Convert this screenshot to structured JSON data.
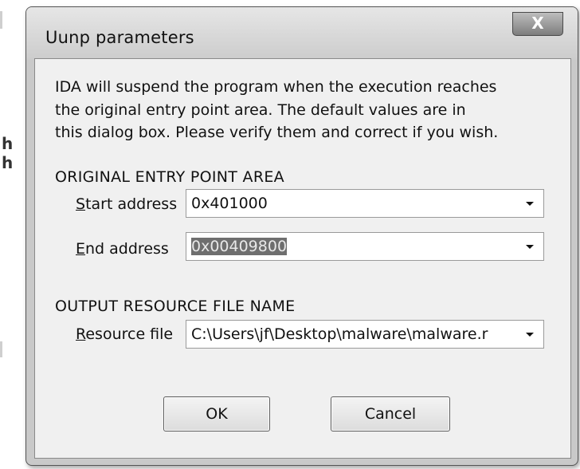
{
  "background": {
    "fragments": [
      "h",
      "h"
    ]
  },
  "dialog": {
    "title": "Uunp parameters",
    "close_label": "X",
    "description_lines": [
      "IDA will suspend the program when the execution reaches",
      "the original entry point area. The default values are in",
      "this dialog box. Please verify them and correct if you wish."
    ],
    "entry_section": {
      "heading": "ORIGINAL ENTRY POINT AREA",
      "start": {
        "label_key": "S",
        "label_rest": "tart address",
        "value": "0x401000"
      },
      "end": {
        "label_key": "E",
        "label_rest": "nd address",
        "value": "0x00409800"
      }
    },
    "output_section": {
      "heading": "OUTPUT RESOURCE FILE NAME",
      "resource": {
        "label_key": "R",
        "label_rest": "esource file",
        "value": "C:\\Users\\jf\\Desktop\\malware\\malware.r"
      }
    },
    "buttons": {
      "ok": "OK",
      "cancel": "Cancel"
    }
  },
  "colors": {
    "client_bg": "#f0f0f0",
    "selection_bg": "#6e6e6e"
  }
}
